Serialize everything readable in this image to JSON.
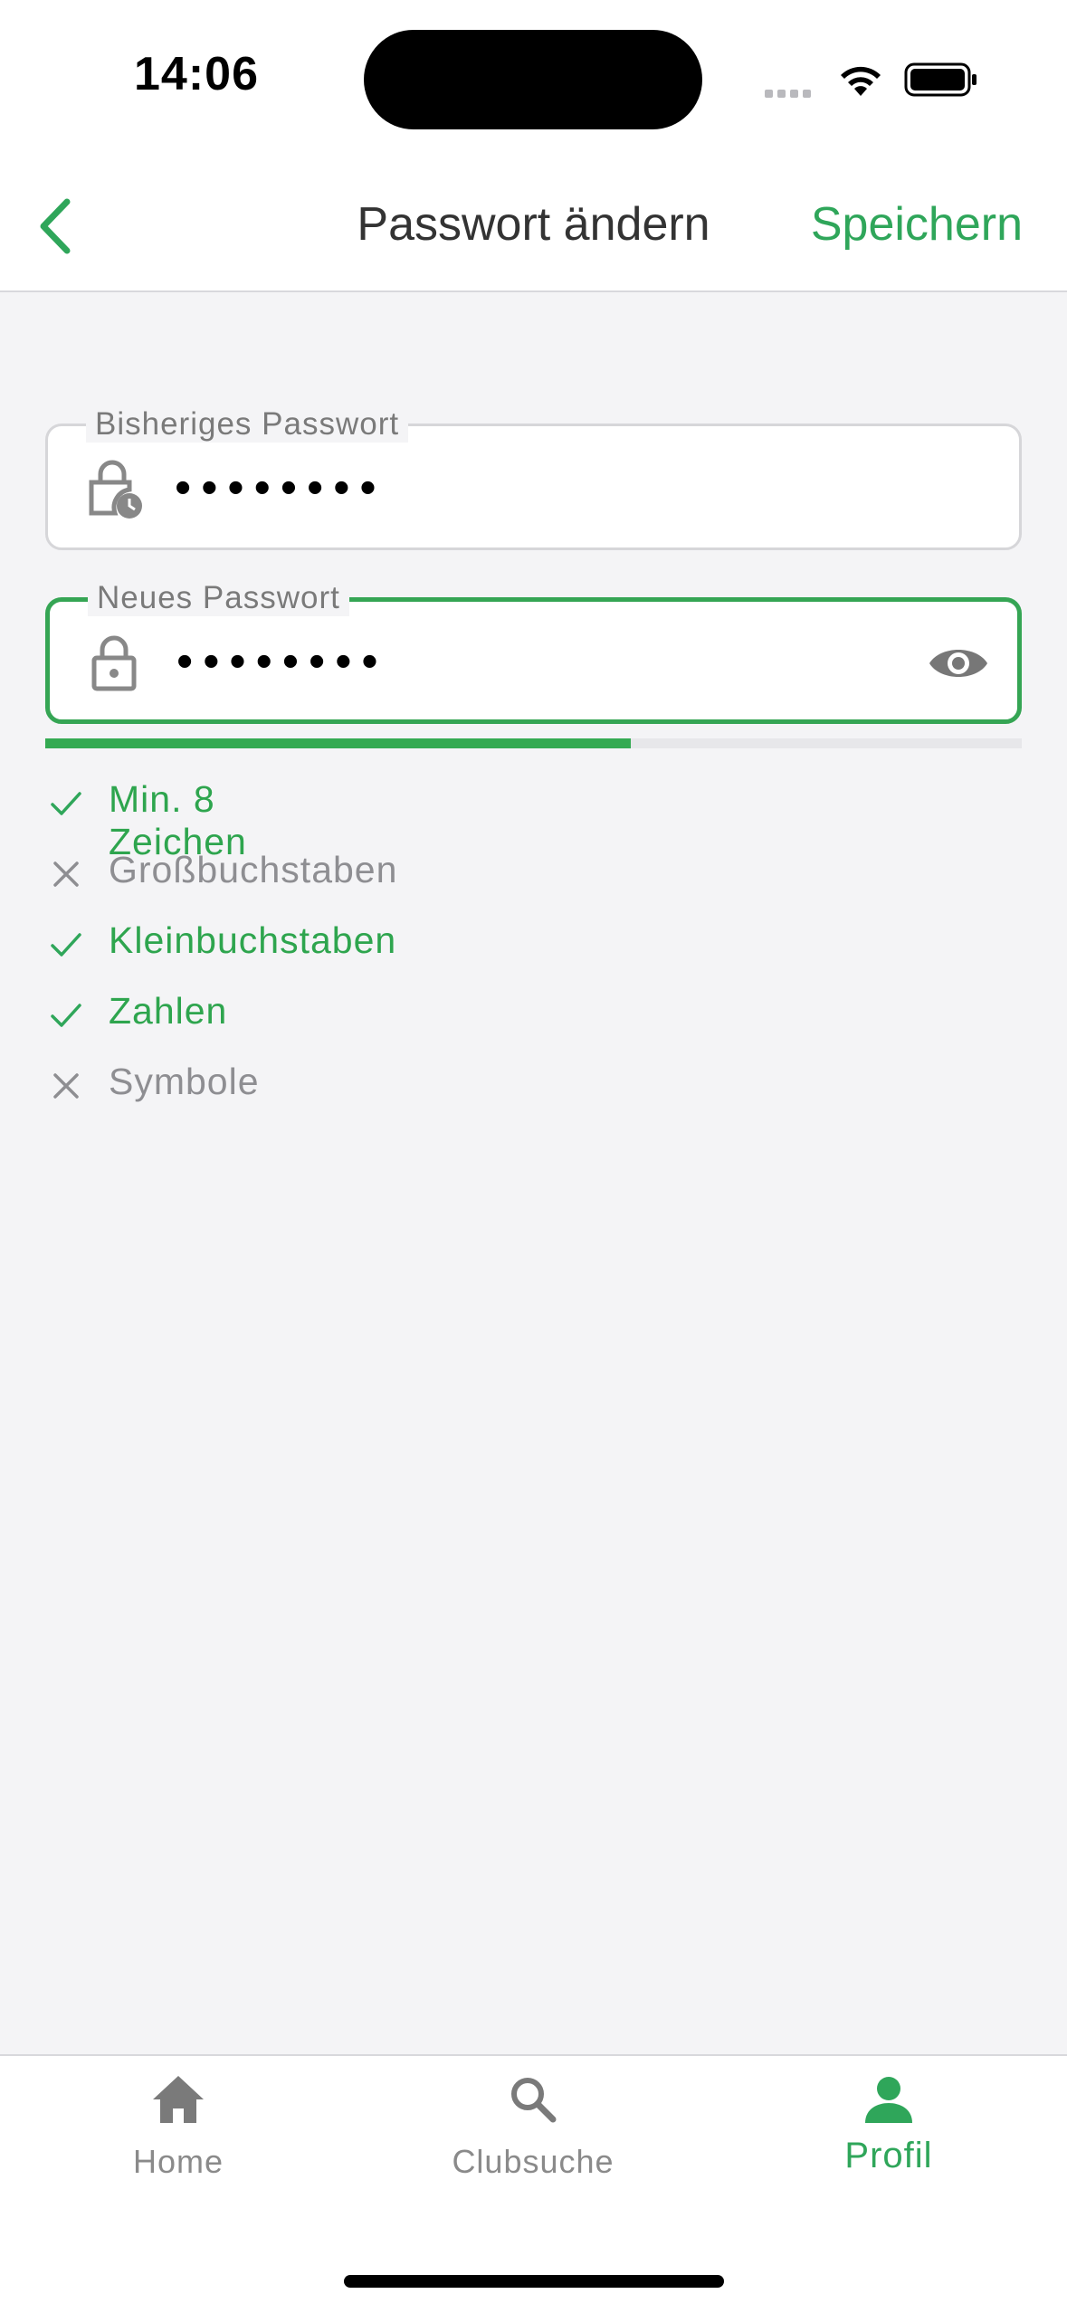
{
  "status_bar": {
    "time": "14:06"
  },
  "nav": {
    "title": "Passwort ändern",
    "save_label": "Speichern"
  },
  "fields": {
    "current": {
      "label": "Bisheriges Passwort",
      "value": "••••••••"
    },
    "new": {
      "label": "Neues Passwort",
      "value": "••••••••"
    }
  },
  "strength": {
    "fraction": 0.6
  },
  "criteria": [
    {
      "label": "Min. 8 Zeichen",
      "met": true
    },
    {
      "label": "Großbuchstaben",
      "met": false
    },
    {
      "label": "Kleinbuchstaben",
      "met": true
    },
    {
      "label": "Zahlen",
      "met": true
    },
    {
      "label": "Symbole",
      "met": false
    }
  ],
  "tabs": [
    {
      "label": "Home",
      "icon": "home-icon",
      "active": false
    },
    {
      "label": "Clubsuche",
      "icon": "search-icon",
      "active": false
    },
    {
      "label": "Profil",
      "icon": "person-icon",
      "active": true
    }
  ],
  "colors": {
    "accent": "#2fa65a",
    "muted": "#8e8e92",
    "background": "#f4f4f6"
  }
}
